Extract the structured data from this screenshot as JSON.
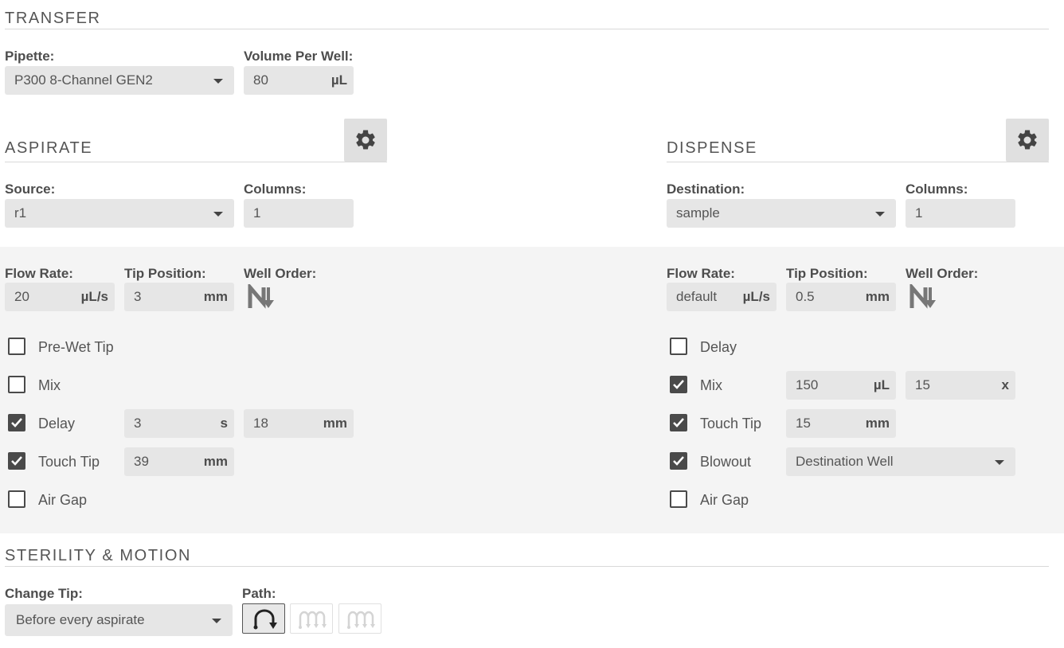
{
  "transfer": {
    "title": "TRANSFER",
    "pipette_label": "Pipette:",
    "pipette_value": "P300 8-Channel GEN2",
    "volume_label": "Volume Per Well:",
    "volume_value": "80",
    "volume_unit": "µL"
  },
  "aspirate": {
    "title": "ASPIRATE",
    "source_label": "Source:",
    "source_value": "r1",
    "columns_label": "Columns:",
    "columns_value": "1",
    "flow_rate_label": "Flow Rate:",
    "flow_rate_value": "20",
    "flow_rate_unit": "µL/s",
    "tip_position_label": "Tip Position:",
    "tip_position_value": "3",
    "tip_position_unit": "mm",
    "well_order_label": "Well Order:",
    "options": [
      {
        "label": "Pre-Wet Tip",
        "checked": false
      },
      {
        "label": "Mix",
        "checked": false
      },
      {
        "label": "Delay",
        "checked": true,
        "fields": [
          {
            "value": "3",
            "unit": "s"
          },
          {
            "value": "18",
            "unit": "mm"
          }
        ]
      },
      {
        "label": "Touch Tip",
        "checked": true,
        "fields": [
          {
            "value": "39",
            "unit": "mm"
          }
        ]
      },
      {
        "label": "Air Gap",
        "checked": false
      }
    ]
  },
  "dispense": {
    "title": "DISPENSE",
    "destination_label": "Destination:",
    "destination_value": "sample",
    "columns_label": "Columns:",
    "columns_value": "1",
    "flow_rate_label": "Flow Rate:",
    "flow_rate_value": "default",
    "flow_rate_unit": "µL/s",
    "tip_position_label": "Tip Position:",
    "tip_position_value": "0.5",
    "tip_position_unit": "mm",
    "well_order_label": "Well Order:",
    "options": [
      {
        "label": "Delay",
        "checked": false
      },
      {
        "label": "Mix",
        "checked": true,
        "fields": [
          {
            "value": "150",
            "unit": "µL"
          },
          {
            "value": "15",
            "unit": "x"
          }
        ]
      },
      {
        "label": "Touch Tip",
        "checked": true,
        "fields": [
          {
            "value": "15",
            "unit": "mm"
          }
        ]
      },
      {
        "label": "Blowout",
        "checked": true,
        "select_value": "Destination Well"
      },
      {
        "label": "Air Gap",
        "checked": false
      }
    ]
  },
  "sterility": {
    "title": "STERILITY & MOTION",
    "change_tip_label": "Change Tip:",
    "change_tip_value": "Before every aspirate",
    "path_label": "Path:",
    "path_options": [
      "single",
      "multi-aspirate",
      "multi-dispense"
    ],
    "path_selected": "single"
  },
  "colors": {
    "field_bg": "#e6e6e6",
    "band_bg": "#f4f4f4",
    "text": "#4a4a4a"
  }
}
